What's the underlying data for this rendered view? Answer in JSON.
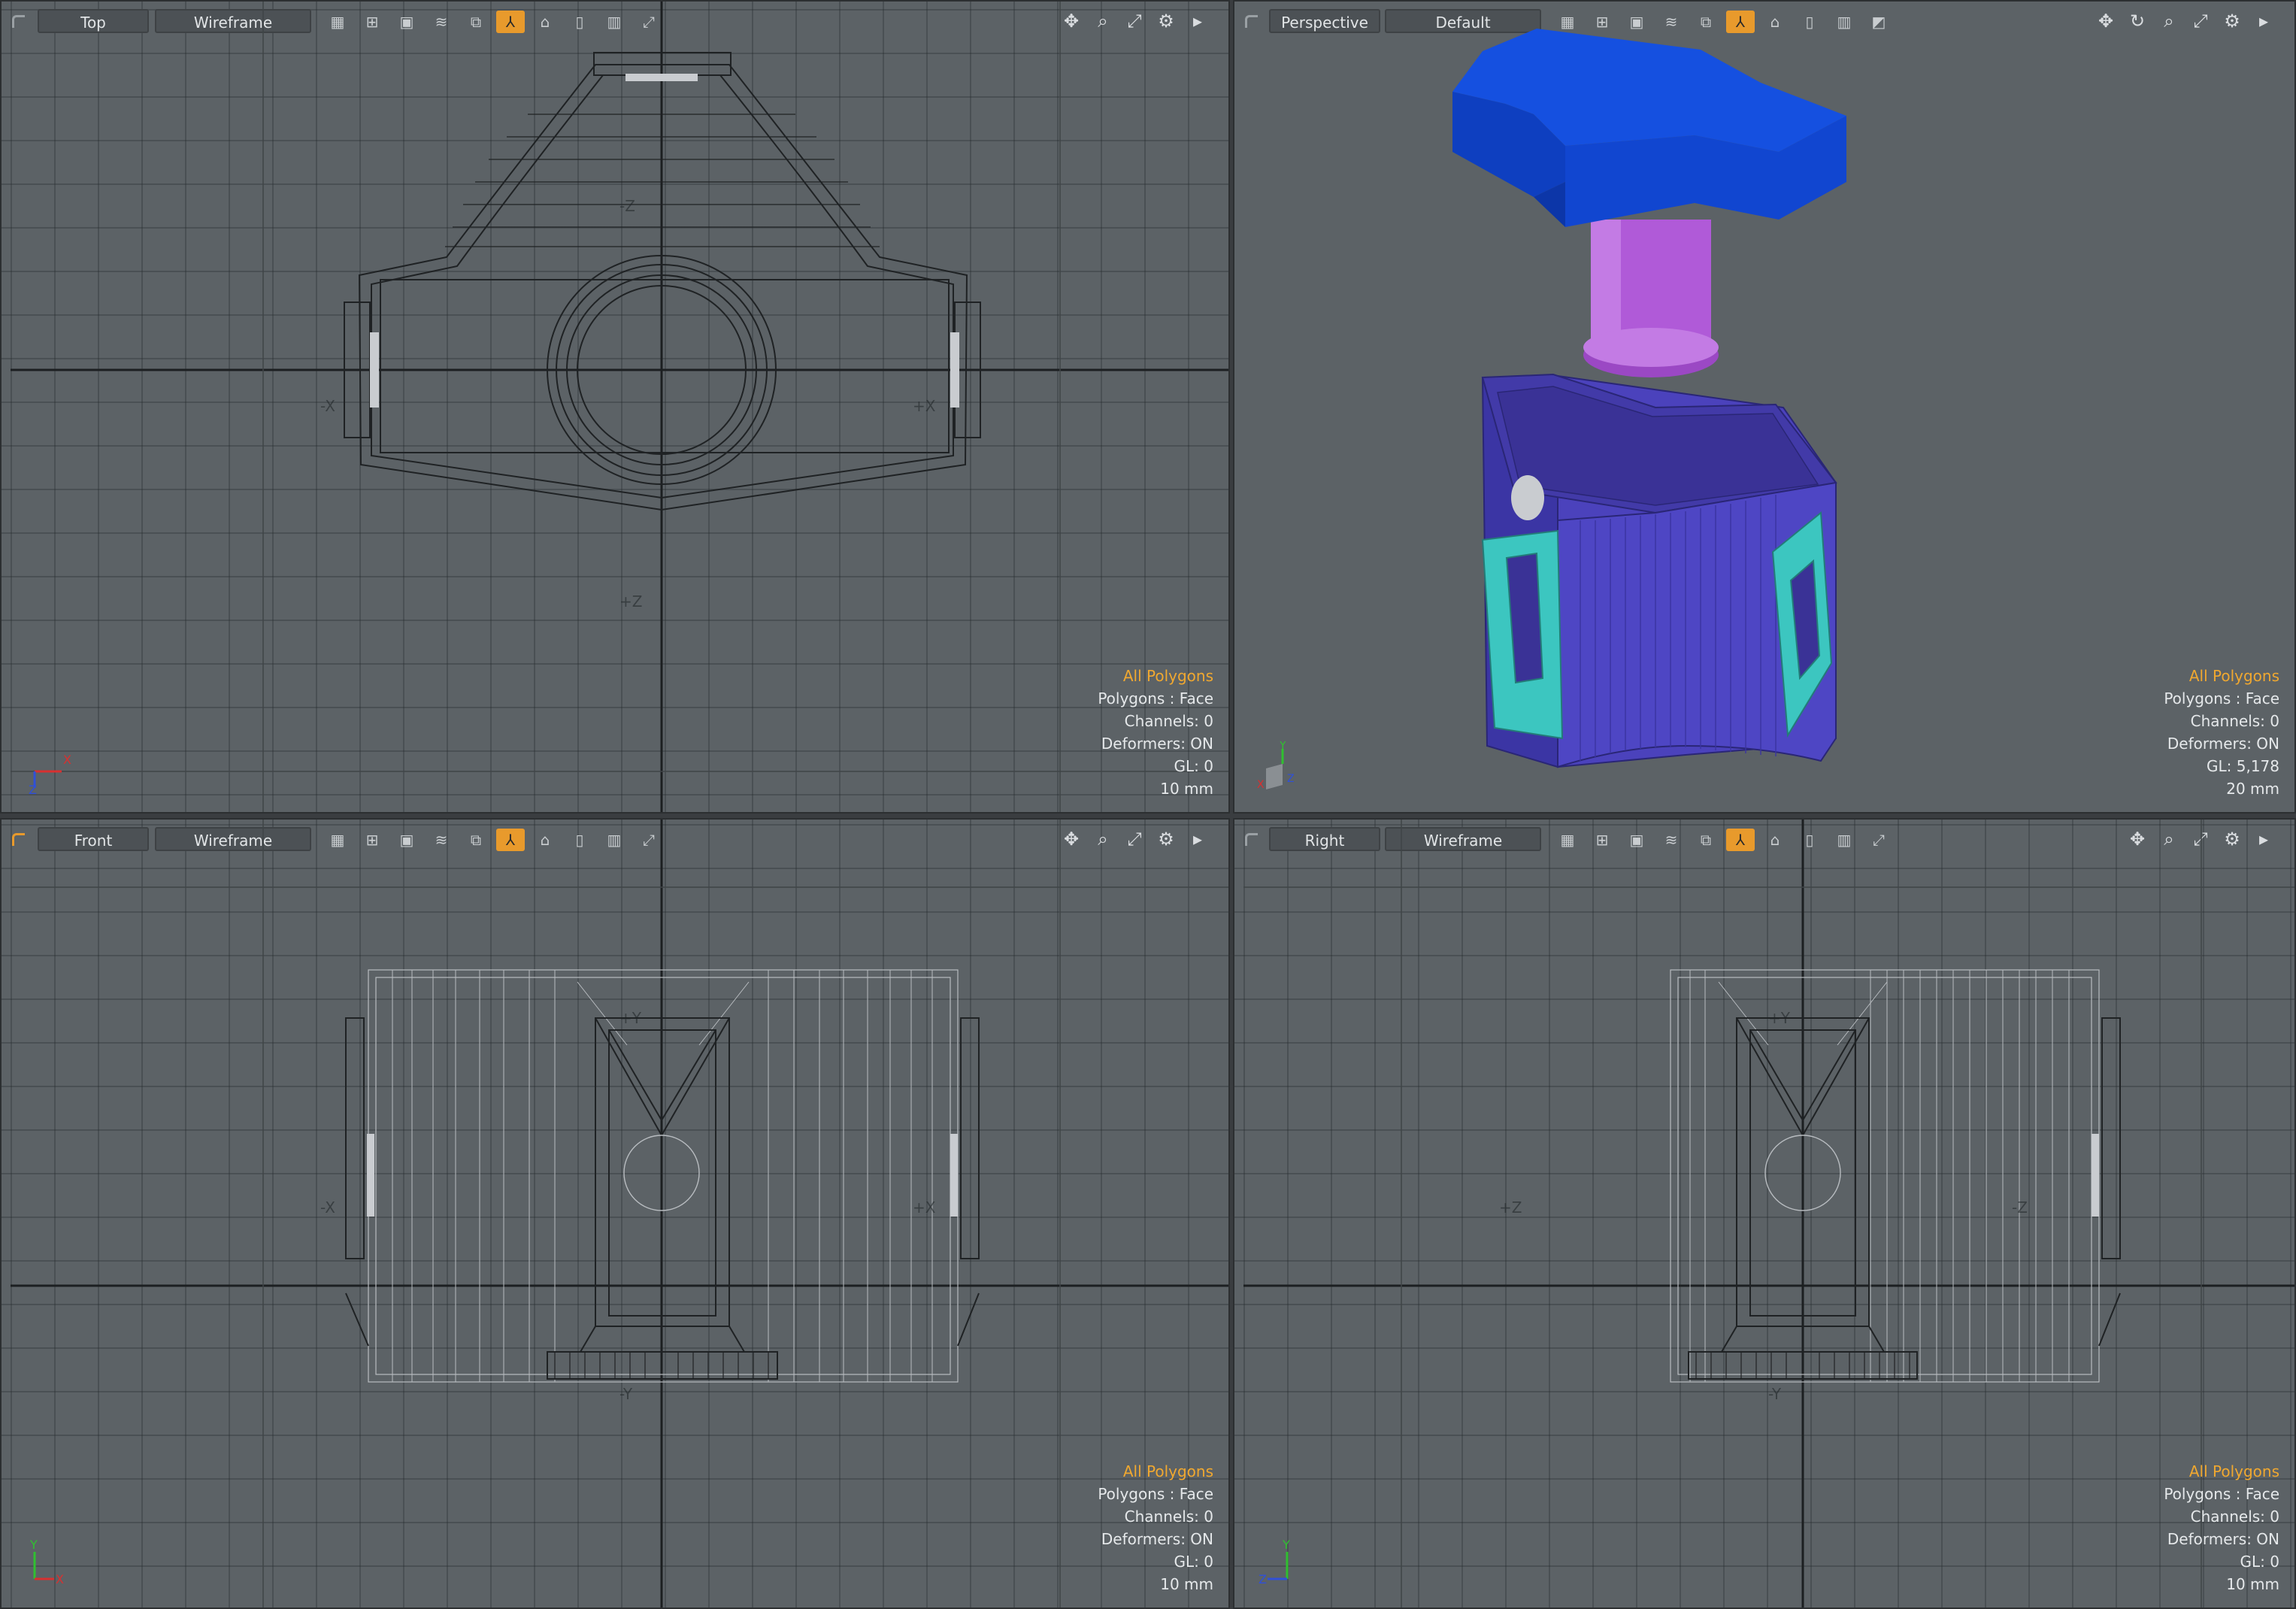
{
  "viewports": {
    "top": {
      "view": "Top",
      "style": "Wireframe",
      "plus_label": "+Z",
      "minus_label": "-Z",
      "x_minus": "-X",
      "x_plus": "+X"
    },
    "persp": {
      "view": "Perspective",
      "style": "Default"
    },
    "front": {
      "view": "Front",
      "style": "Wireframe",
      "y_plus": "+Y",
      "y_minus": "-Y",
      "x_minus": "-X",
      "x_plus": "+X"
    },
    "right": {
      "view": "Right",
      "style": "Wireframe",
      "y_plus": "+Y",
      "y_minus": "-Y",
      "z_minus": "+Z",
      "z_plus": "-Z"
    }
  },
  "info": {
    "top": {
      "selection": "All Polygons",
      "polygons": "Polygons : Face",
      "channels": "Channels: 0",
      "deformers": "Deformers: ON",
      "gl": "GL: 0",
      "scale": "10 mm"
    },
    "persp": {
      "selection": "All Polygons",
      "polygons": "Polygons : Face",
      "channels": "Channels: 0",
      "deformers": "Deformers: ON",
      "gl": "GL: 5,178",
      "scale": "20 mm"
    },
    "front": {
      "selection": "All Polygons",
      "polygons": "Polygons : Face",
      "channels": "Channels: 0",
      "deformers": "Deformers: ON",
      "gl": "GL: 0",
      "scale": "10 mm"
    },
    "right": {
      "selection": "All Polygons",
      "polygons": "Polygons : Face",
      "channels": "Channels: 0",
      "deformers": "Deformers: ON",
      "gl": "GL: 0",
      "scale": "10 mm"
    }
  },
  "toolbar_icons": [
    "checker-icon",
    "grid-icon",
    "solid-icon",
    "hair-icon",
    "layers-icon",
    "axis-icon",
    "mesh-icon",
    "brush-icon",
    "book-icon",
    "expand-icon"
  ],
  "nav_icons": [
    "move-icon",
    "zoom-icon",
    "fit-icon",
    "settings-icon",
    "more-icon"
  ],
  "colors": {
    "accent": "#e89a2c",
    "selection_text": "#f0a830",
    "viewport_bg": "#5c6266",
    "lid": "#1550e0",
    "shaft": "#b05ad8",
    "body": "#4a3fb8",
    "brackets": "#3cc6c0"
  }
}
